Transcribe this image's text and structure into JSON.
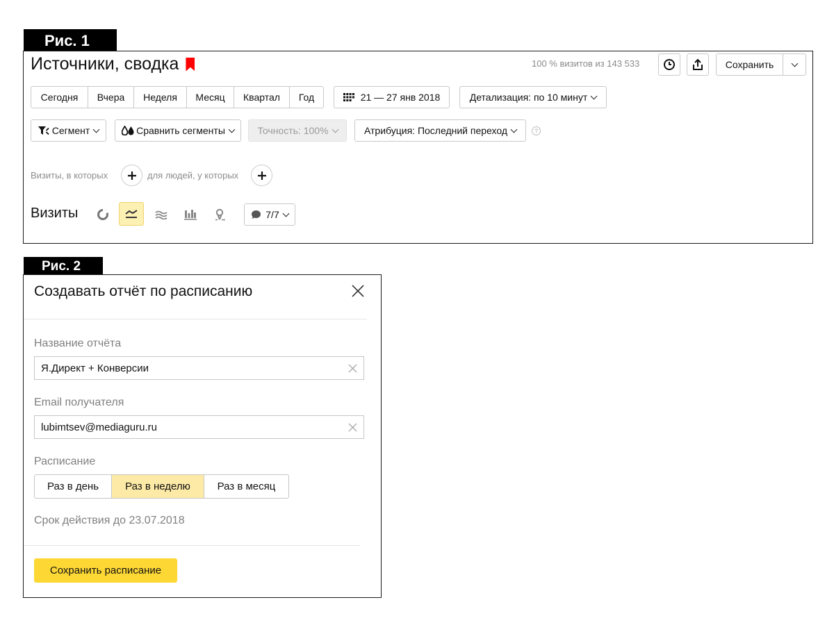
{
  "figure_tags": {
    "fig1": "Рис. 1",
    "fig2": "Рис. 2"
  },
  "report": {
    "title": "Источники, сводка",
    "bookmark_color": "#ff0000",
    "visits_info": "100 % визитов из 143 533",
    "icons": {
      "history": "clock-icon",
      "export": "share-export-icon"
    },
    "save_label": "Сохранить",
    "periods": [
      "Сегодня",
      "Вчера",
      "Неделя",
      "Месяц",
      "Квартал",
      "Год"
    ],
    "date_range": "21 — 27 янв 2018",
    "detail_label": "Детализация: по 10 минут",
    "segment_label": "Сегмент",
    "compare_label": "Сравнить сегменты",
    "accuracy_label": "Точность: 100%",
    "attribution_label": "Атрибуция: Последний переход",
    "help_glyph": "?",
    "visits_condition": "Визиты, в которых",
    "people_condition": "для людей, у которых",
    "visits_heading": "Визиты",
    "chart_types": [
      "pie-chart-icon",
      "line-chart-icon",
      "area-chart-icon",
      "bar-chart-icon",
      "map-icon"
    ],
    "active_chart_type": "line-chart-icon",
    "metrics_count": "7/7"
  },
  "dialog": {
    "title": "Создавать отчёт по расписанию",
    "name_label": "Название отчёта",
    "name_value": "Я.Директ + Конверсии",
    "email_label": "Email получателя",
    "email_value": "lubimtsev@mediaguru.ru",
    "schedule_label": "Расписание",
    "schedule_options": [
      "Раз в день",
      "Раз в неделю",
      "Раз в месяц"
    ],
    "schedule_selected": "Раз в неделю",
    "valid_until": "Срок действия до 23.07.2018",
    "submit_label": "Сохранить расписание",
    "accent_color": "#fdd835"
  }
}
